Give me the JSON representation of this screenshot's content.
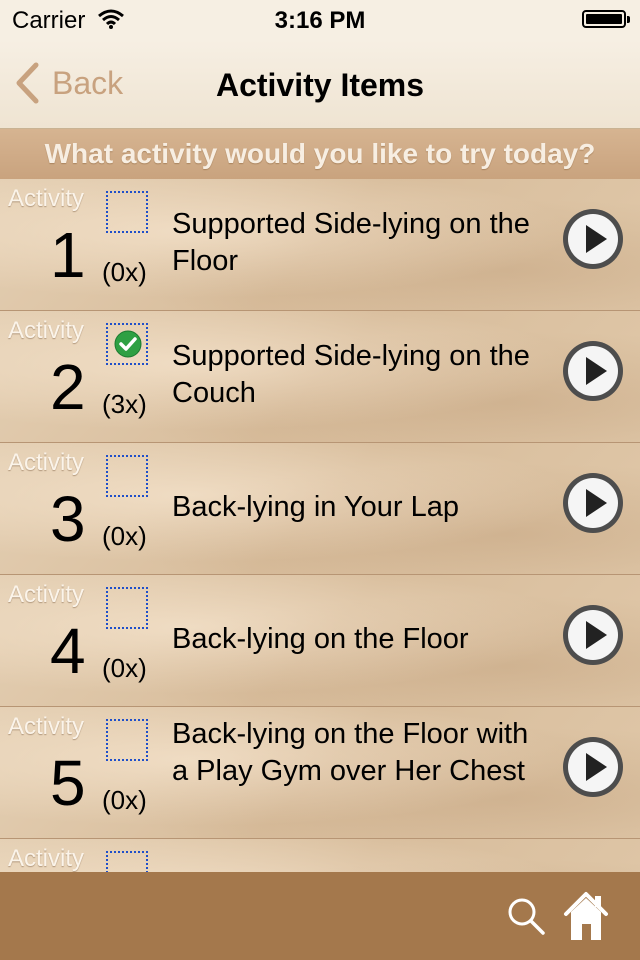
{
  "status_bar": {
    "carrier": "Carrier",
    "time": "3:16 PM"
  },
  "nav": {
    "back_label": "Back",
    "title": "Activity Items"
  },
  "prompt": "What activity would you like to try today?",
  "activities": [
    {
      "label": "Activity",
      "number": "1",
      "count": "(0x)",
      "checked": false,
      "title": "Supported Side-lying on the Floor"
    },
    {
      "label": "Activity",
      "number": "2",
      "count": "(3x)",
      "checked": true,
      "title": "Supported Side-lying on the Couch"
    },
    {
      "label": "Activity",
      "number": "3",
      "count": "(0x)",
      "checked": false,
      "title": "Back-lying in Your Lap"
    },
    {
      "label": "Activity",
      "number": "4",
      "count": "(0x)",
      "checked": false,
      "title": "Back-lying on the Floor"
    },
    {
      "label": "Activity",
      "number": "5",
      "count": "(0x)",
      "checked": false,
      "title": "Back-lying on the Floor with a Play Gym over Her Chest"
    },
    {
      "label": "Activity",
      "number": "",
      "count": "",
      "checked": false,
      "title": ""
    }
  ],
  "icons": {
    "back": "chevron-left-icon",
    "checkbox": "checkbox-icon",
    "checked": "check-circle-icon",
    "play": "play-icon",
    "search": "search-icon",
    "home": "home-icon"
  },
  "colors": {
    "accent": "#c8a27f",
    "bottom_bar": "#a4784c",
    "checkbox_border": "#1f4fc9",
    "check_green": "#2ea043"
  }
}
